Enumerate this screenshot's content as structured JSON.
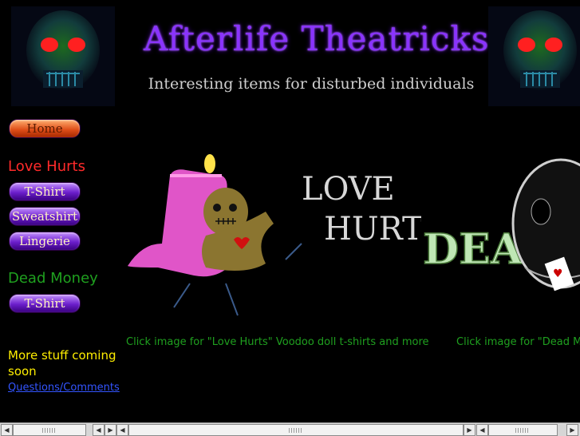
{
  "header": {
    "title": "Afterlife Theatricks",
    "subtitle": "Interesting items for disturbed individuals"
  },
  "nav": {
    "home": "Home",
    "love_section": "Love Hurts",
    "love_items": [
      "T-Shirt",
      "Sweatshirt",
      "Lingerie"
    ],
    "dead_section": "Dead Money",
    "dead_items": [
      "T-Shirt"
    ],
    "more_text": "More stuff coming soon",
    "questions_link": "Questions/Comments"
  },
  "main": {
    "love_banner_text": [
      "LOVE",
      "HURTS"
    ],
    "dead_banner_text": "DEAD",
    "love_caption": "Click image for \"Love Hurts\" Voodoo doll t-shirts and more",
    "dead_caption": "Click image for \"Dead Mo"
  },
  "colors": {
    "title": "#8a33ff",
    "love": "#ff2a2a",
    "dead": "#1fa01f",
    "more": "#ffee00",
    "link": "#3355ff"
  },
  "icons": [
    "skull-icon",
    "voodoo-doll-icon",
    "skull-icon"
  ]
}
